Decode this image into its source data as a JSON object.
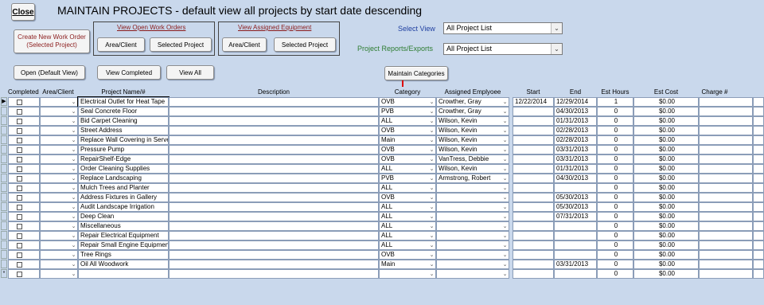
{
  "header": {
    "close_label": "Close",
    "title": "MAINTAIN PROJECTS - default view all projects by start date descending"
  },
  "toolbar": {
    "create_label": "Create New Work Order (Selected Project)",
    "open_group_label": "View Open Work Orders",
    "assigned_group_label": "View Assigned Equipment",
    "area_client_label": "Area/Client",
    "selected_project_label": "Selected Project",
    "select_view_label": "Select View",
    "select_view_value": "All Project List",
    "reports_label": "Project Reports/Exports",
    "reports_value": "All Project List",
    "open_default_label": "Open (Default View)",
    "view_completed_label": "View Completed",
    "view_all_label": "View All",
    "maintain_categories_label": "Maintain Categories"
  },
  "colors": {
    "background": "#c9d8ec",
    "accent_red": "#8b1c1c",
    "select_view_blue": "#1f3fa0",
    "reports_green": "#2e7d32"
  },
  "grid": {
    "columns": [
      "Completed",
      "Area/Client",
      "Project Name/#",
      "Description",
      "Category",
      "Assigned Emplyoee",
      "Start",
      "End",
      "Est Hours",
      "Est Cost",
      "Charge #"
    ],
    "rows": [
      {
        "name": "Electrical Outlet for Heat Tape",
        "category": "OVB",
        "employee": "Crowther, Gray",
        "start": "12/22/2014",
        "end": "12/29/2014",
        "hours": "1",
        "cost": "$0.00"
      },
      {
        "name": "Seal Concrete Floor",
        "category": "PVB",
        "employee": "Crowther, Gray",
        "start": "",
        "end": "04/30/2013",
        "hours": "0",
        "cost": "$0.00"
      },
      {
        "name": "Bid Carpet Cleaning",
        "category": "ALL",
        "employee": "Wilson, Kevin",
        "start": "",
        "end": "01/31/2013",
        "hours": "0",
        "cost": "$0.00"
      },
      {
        "name": "Street Address",
        "category": "OVB",
        "employee": "Wilson, Kevin",
        "start": "",
        "end": "02/28/2013",
        "hours": "0",
        "cost": "$0.00"
      },
      {
        "name": "Replace Wall Covering in Server",
        "category": "Main",
        "employee": "Wilson, Kevin",
        "start": "",
        "end": "02/28/2013",
        "hours": "0",
        "cost": "$0.00"
      },
      {
        "name": "Pressure Pump",
        "category": "OVB",
        "employee": "Wilson, Kevin",
        "start": "",
        "end": "03/31/2013",
        "hours": "0",
        "cost": "$0.00"
      },
      {
        "name": "RepairShelf-Edge",
        "category": "OVB",
        "employee": "VanTress, Debbie",
        "start": "",
        "end": "03/31/2013",
        "hours": "0",
        "cost": "$0.00"
      },
      {
        "name": "Order Cleaning Supplies",
        "category": "ALL",
        "employee": "Wilson, Kevin",
        "start": "",
        "end": "01/31/2013",
        "hours": "0",
        "cost": "$0.00"
      },
      {
        "name": "Replace Landscaping",
        "category": "PVB",
        "employee": "Armstrong, Robert",
        "start": "",
        "end": "04/30/2013",
        "hours": "0",
        "cost": "$0.00"
      },
      {
        "name": "Mulch Trees and Planter",
        "category": "ALL",
        "employee": "",
        "start": "",
        "end": "",
        "hours": "0",
        "cost": "$0.00"
      },
      {
        "name": "Address Fixtures in Gallery",
        "category": "OVB",
        "employee": "",
        "start": "",
        "end": "05/30/2013",
        "hours": "0",
        "cost": "$0.00"
      },
      {
        "name": "Audit Landscape Irrigation",
        "category": "ALL",
        "employee": "",
        "start": "",
        "end": "05/30/2013",
        "hours": "0",
        "cost": "$0.00"
      },
      {
        "name": "Deep Clean",
        "category": "ALL",
        "employee": "",
        "start": "",
        "end": "07/31/2013",
        "hours": "0",
        "cost": "$0.00"
      },
      {
        "name": "Miscellaneous",
        "category": "ALL",
        "employee": "",
        "start": "",
        "end": "",
        "hours": "0",
        "cost": "$0.00"
      },
      {
        "name": "Repair Electrical Equipment",
        "category": "ALL",
        "employee": "",
        "start": "",
        "end": "",
        "hours": "0",
        "cost": "$0.00"
      },
      {
        "name": "Repair Small Engine Equipment",
        "category": "ALL",
        "employee": "",
        "start": "",
        "end": "",
        "hours": "0",
        "cost": "$0.00"
      },
      {
        "name": "Tree Rings",
        "category": "OVB",
        "employee": "",
        "start": "",
        "end": "",
        "hours": "0",
        "cost": "$0.00"
      },
      {
        "name": "Oil All Woodwork",
        "category": "Main",
        "employee": "",
        "start": "",
        "end": "03/31/2013",
        "hours": "0",
        "cost": "$0.00"
      },
      {
        "name": "",
        "category": "",
        "employee": "",
        "start": "",
        "end": "",
        "hours": "0",
        "cost": "$0.00"
      }
    ],
    "current_row_marker": "▶",
    "new_row_marker": "*"
  }
}
